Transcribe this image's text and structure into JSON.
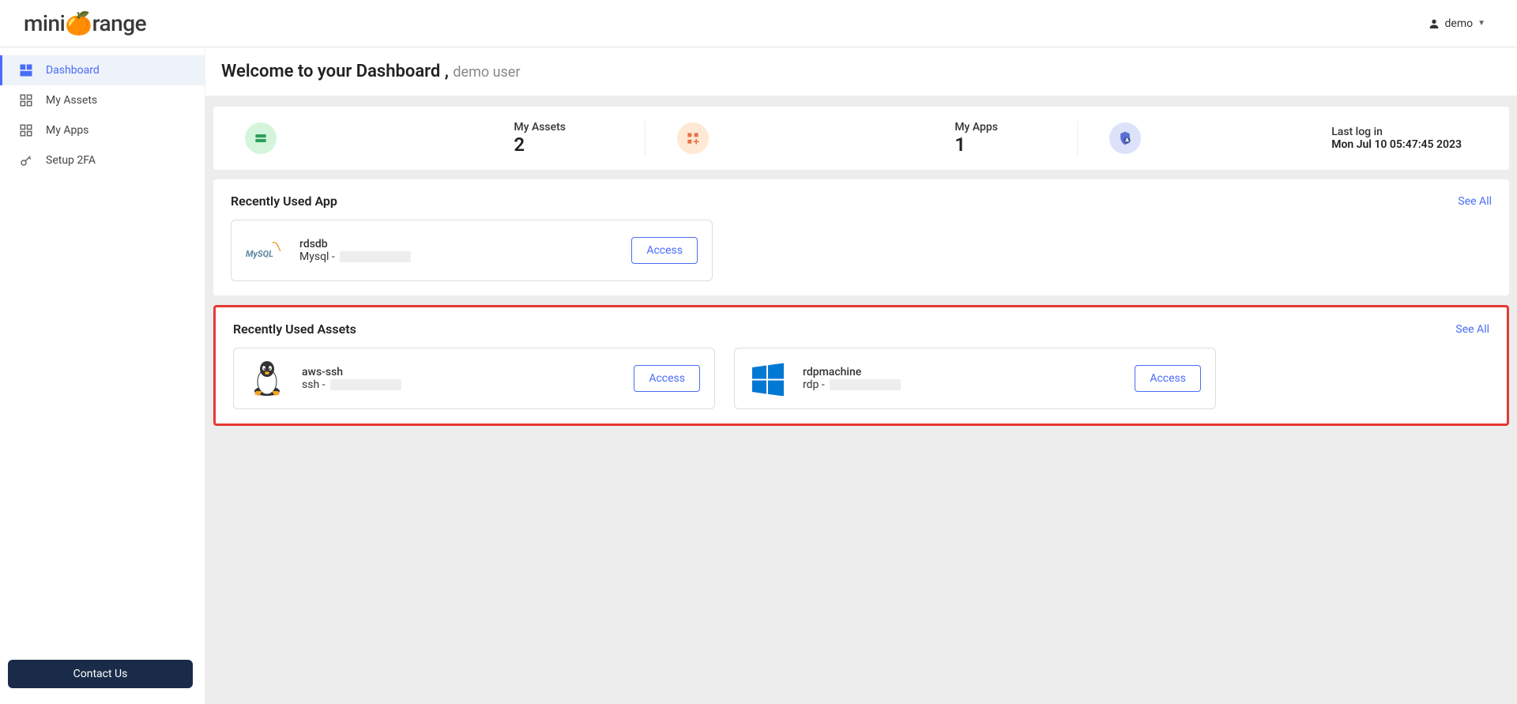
{
  "header": {
    "logo_prefix": "mini",
    "logo_highlight": "⊙",
    "logo_suffix": "range",
    "user_name": "demo"
  },
  "sidebar": {
    "items": [
      {
        "label": "Dashboard"
      },
      {
        "label": "My Assets"
      },
      {
        "label": "My Apps"
      },
      {
        "label": "Setup 2FA"
      }
    ],
    "contact_label": "Contact Us"
  },
  "welcome": {
    "title": "Welcome to your Dashboard ,",
    "username": "demo user"
  },
  "stats": {
    "assets": {
      "label": "My Assets",
      "value": "2"
    },
    "apps": {
      "label": "My Apps",
      "value": "1"
    },
    "login": {
      "label": "Last log in",
      "value": "Mon Jul 10 05:47:45 2023"
    }
  },
  "sections": {
    "apps": {
      "title": "Recently Used App",
      "see_all": "See All",
      "items": [
        {
          "name": "rdsdb",
          "type": "Mysql -",
          "access": "Access"
        }
      ]
    },
    "assets": {
      "title": "Recently Used Assets",
      "see_all": "See All",
      "items": [
        {
          "name": "aws-ssh",
          "type": "ssh -",
          "access": "Access"
        },
        {
          "name": "rdpmachine",
          "type": "rdp -",
          "access": "Access"
        }
      ]
    }
  }
}
